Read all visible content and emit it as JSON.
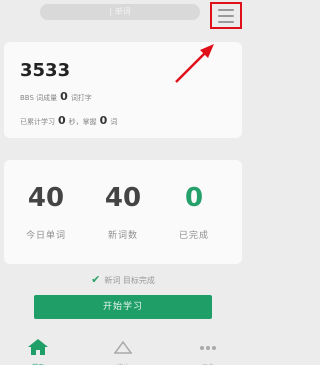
{
  "header": {
    "search_text": "| 单词"
  },
  "summary": {
    "count": "3533",
    "line1_prefix": "BBS 词成量",
    "line1_value": "0",
    "line1_suffix": "词打字",
    "line2_prefix": "已累计学习",
    "line2_value1": "0",
    "line2_mid": "秒，掌握",
    "line2_value2": "0",
    "line2_suffix": "词"
  },
  "stats": [
    {
      "value": "40",
      "label": "今日单词"
    },
    {
      "value": "40",
      "label": "新词数"
    },
    {
      "value": "0",
      "label": "已完成"
    }
  ],
  "status_text": "新词 目标完成",
  "start_button": "开始学习",
  "tabs": [
    {
      "label": "首页"
    },
    {
      "label": "统计"
    },
    {
      "label": "更多"
    }
  ],
  "colors": {
    "accent": "#1f9e68",
    "highlight_border": "#e0101a"
  }
}
